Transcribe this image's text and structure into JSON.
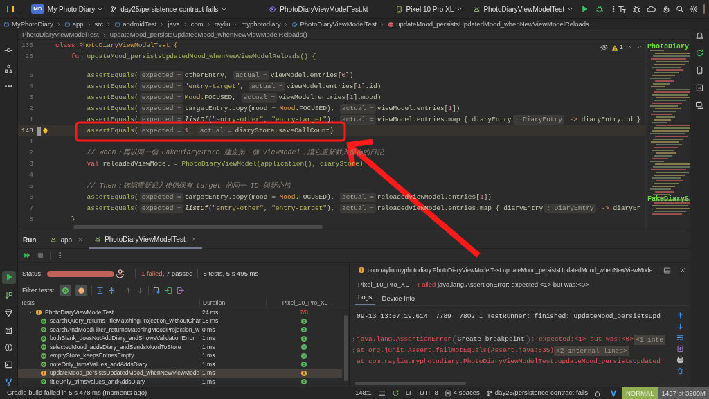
{
  "titlebar": {
    "project_badge": "MD",
    "project": "My Photo Diary",
    "branch": "day25/persistence-contract-fails",
    "file": "PhotoDiaryViewModelTest.kt",
    "device": "Pixel 10 Pro XL",
    "run_config": "PhotoDiaryViewModelTest"
  },
  "breadcrumbs": [
    {
      "text": "MyPhotoDiary",
      "kind": "module"
    },
    {
      "text": "app",
      "kind": "folder"
    },
    {
      "text": "src",
      "kind": "plain"
    },
    {
      "text": "androidTest",
      "kind": "folder"
    },
    {
      "text": "java",
      "kind": "plain"
    },
    {
      "text": "com",
      "kind": "plain"
    },
    {
      "text": "rayliu",
      "kind": "plain"
    },
    {
      "text": "myphotodiary",
      "kind": "plain"
    },
    {
      "text": "PhotoDiaryViewModelTest",
      "kind": "class"
    },
    {
      "text": "updateMood_persistsUpdatedMood_whenNewViewModelReloads",
      "kind": "method"
    }
  ],
  "editor": {
    "path": [
      "PhotoDiaryViewModelTest",
      "updateMood_persistsUpdatedMood_whenNewViewModelReloads()"
    ],
    "warnings": "1",
    "sticky_lines": [
      {
        "number": "135",
        "tokens": [
          {
            "text": "class ",
            "kind": "kw"
          },
          {
            "text": "PhotoDiaryViewModelTest {",
            "kind": "type"
          }
        ]
      },
      {
        "number": "25",
        "tokens": [
          {
            "text": "    fun ",
            "kind": "kw"
          },
          {
            "text": "updateMood_persistsUpdatedMood_whenNewViewModelReloads() {",
            "kind": "fn"
          }
        ]
      }
    ],
    "lines": [
      {
        "number": "5",
        "current": false,
        "tokens": [
          {
            "text": "        assertEquals(",
            "kind": "fn"
          },
          {
            "text": "expected =",
            "kind": "hint"
          },
          {
            "text": "otherEntry, ",
            "kind": "plain"
          },
          {
            "text": "actual =",
            "kind": "hint"
          },
          {
            "text": "viewModel.entries[",
            "kind": "plain"
          },
          {
            "text": "0",
            "kind": "num"
          },
          {
            "text": "])",
            "kind": "plain"
          }
        ]
      },
      {
        "number": "4",
        "current": false,
        "tokens": [
          {
            "text": "        assertEquals(",
            "kind": "fn"
          },
          {
            "text": "expected =",
            "kind": "hint"
          },
          {
            "text": "\"entry-target\"",
            "kind": "str"
          },
          {
            "text": ", ",
            "kind": "plain"
          },
          {
            "text": "actual =",
            "kind": "hint"
          },
          {
            "text": "viewModel.entries[",
            "kind": "plain"
          },
          {
            "text": "1",
            "kind": "num"
          },
          {
            "text": "].id)",
            "kind": "plain"
          }
        ]
      },
      {
        "number": "3",
        "current": false,
        "tokens": [
          {
            "text": "        assertEquals(",
            "kind": "fn"
          },
          {
            "text": "expected =",
            "kind": "hint"
          },
          {
            "text": "Mood",
            "kind": "type"
          },
          {
            "text": ".FOCUSED, ",
            "kind": "plain"
          },
          {
            "text": "actual =",
            "kind": "hint"
          },
          {
            "text": "viewModel.entries[",
            "kind": "plain"
          },
          {
            "text": "1",
            "kind": "num"
          },
          {
            "text": "].mood)",
            "kind": "plain"
          }
        ]
      },
      {
        "number": "2",
        "current": false,
        "tokens": [
          {
            "text": "        assertEquals(",
            "kind": "fn"
          },
          {
            "text": "expected =",
            "kind": "hint"
          },
          {
            "text": "targetEntry.copy(mood = ",
            "kind": "plain"
          },
          {
            "text": "Mood",
            "kind": "type"
          },
          {
            "text": ".FOCUSED), ",
            "kind": "plain"
          },
          {
            "text": "actual =",
            "kind": "hint"
          },
          {
            "text": "viewModel.entries[",
            "kind": "plain"
          },
          {
            "text": "1",
            "kind": "num"
          },
          {
            "text": "])",
            "kind": "plain"
          }
        ]
      },
      {
        "number": "1",
        "current": false,
        "tokens": [
          {
            "text": "        assertEquals(",
            "kind": "fn"
          },
          {
            "text": "expected =",
            "kind": "hint"
          },
          {
            "text": "listOf",
            "kind": "italic"
          },
          {
            "text": "(",
            "kind": "plain"
          },
          {
            "text": "\"entry-other\", \"entry-target\"",
            "kind": "str"
          },
          {
            "text": "), ",
            "kind": "plain"
          },
          {
            "text": "actual =",
            "kind": "hint"
          },
          {
            "text": "viewModel.entries.map { diaryEntry",
            "kind": "plain"
          },
          {
            "text": ": DiaryEntry",
            "kind": "hint"
          },
          {
            "text": " -> ",
            "kind": "op"
          },
          {
            "text": "diaryEntry.id }",
            "kind": "plain"
          }
        ]
      },
      {
        "number": "148",
        "current": true,
        "tokens": [
          {
            "text": "        assertEquals(",
            "kind": "fn"
          },
          {
            "text": "expected =",
            "kind": "hint"
          },
          {
            "text": "1",
            "kind": "num"
          },
          {
            "text": ", ",
            "kind": "plain"
          },
          {
            "text": "actual =",
            "kind": "hint"
          },
          {
            "text": "diaryStore.saveCallCount)",
            "kind": "plain"
          }
        ]
      },
      {
        "number": "1",
        "current": false
      },
      {
        "number": "2",
        "current": false,
        "tokens": [
          {
            "text": "        // When：再以同一個 FakeDiaryStore 建立第二個 ViewModel，讓它重新載入保存的日記",
            "kind": "comment"
          }
        ]
      },
      {
        "number": "3",
        "current": false,
        "tokens": [
          {
            "text": "        val ",
            "kind": "kw"
          },
          {
            "text": "reloadedViewModel = ",
            "kind": "plain"
          },
          {
            "text": "PhotoDiaryViewModel(application(), diaryStore)",
            "kind": "fn"
          }
        ]
      },
      {
        "number": "4",
        "current": false
      },
      {
        "number": "5",
        "current": false,
        "tokens": [
          {
            "text": "        // Then：確認重新載入後仍保有 target 的同一 ID 與新心情",
            "kind": "comment"
          }
        ]
      },
      {
        "number": "6",
        "current": false,
        "tokens": [
          {
            "text": "        assertEquals(",
            "kind": "fn"
          },
          {
            "text": "expected =",
            "kind": "hint"
          },
          {
            "text": "targetEntry.copy(mood = ",
            "kind": "plain"
          },
          {
            "text": "Mood",
            "kind": "type"
          },
          {
            "text": ".FOCUSED), ",
            "kind": "plain"
          },
          {
            "text": "actual =",
            "kind": "hint"
          },
          {
            "text": "reloadedViewModel.entries[",
            "kind": "plain"
          },
          {
            "text": "1",
            "kind": "num"
          },
          {
            "text": "])",
            "kind": "plain"
          }
        ]
      },
      {
        "number": "7",
        "current": false,
        "tokens": [
          {
            "text": "        assertEquals(",
            "kind": "fn"
          },
          {
            "text": "expected =",
            "kind": "hint"
          },
          {
            "text": "listOf",
            "kind": "italic"
          },
          {
            "text": "(",
            "kind": "plain"
          },
          {
            "text": "\"entry-other\", \"entry-target\"",
            "kind": "str"
          },
          {
            "text": "), ",
            "kind": "plain"
          },
          {
            "text": "actual =",
            "kind": "hint"
          },
          {
            "text": "reloadedViewModel.entries.map { diaryEntry",
            "kind": "plain"
          },
          {
            "text": ": DiaryEntry",
            "kind": "hint"
          },
          {
            "text": " -> ",
            "kind": "op"
          },
          {
            "text": "diaryEr",
            "kind": "plain"
          }
        ]
      },
      {
        "number": "8",
        "current": false,
        "tokens": [
          {
            "text": "    }",
            "kind": "plain"
          }
        ]
      }
    ],
    "minimap_labels": [
      "PhotoDiary",
      "FakeDiaryS"
    ]
  },
  "run_panel": {
    "label": "Run",
    "tabs": [
      {
        "label": "app",
        "selected": false
      },
      {
        "label": "PhotoDiaryViewModelTest",
        "selected": true
      }
    ],
    "status": {
      "label": "Status",
      "level": 1,
      "failed": "1 failed",
      "passed": ", 7 passed",
      "summary": "8 tests, 5 s 495 ms"
    },
    "filter": {
      "label": "Filter tests:",
      "toggles": [
        {
          "kind": "passed",
          "selected": true
        },
        {
          "kind": "ignored",
          "selected": true
        }
      ]
    },
    "columns": [
      "Tests",
      "Duration",
      "Pixel_10_Pro_XL"
    ],
    "root": {
      "name": "PhotoDiaryViewModelTest",
      "kind": "failed",
      "duration": "24 ms",
      "device": "7/8",
      "expanded": true,
      "selected": false,
      "children": [
        {
          "name": "searchQuery_returnsTitleMatchingProjection_withoutChar",
          "kind": "passed",
          "duration": "18 ms",
          "selected": false
        },
        {
          "name": "searchAndMoodFilter_returnsMatchingMoodProjection_w",
          "kind": "passed",
          "duration": "0 ms",
          "selected": false
        },
        {
          "name": "bothBlank_doesNotAddDiary_andShowsValidationError",
          "kind": "passed",
          "duration": "1 ms",
          "selected": false
        },
        {
          "name": "selectedMood_addsDiary_andSendsMoodToStore",
          "kind": "passed",
          "duration": "1 ms",
          "selected": false
        },
        {
          "name": "emptyStore_keepsEntriesEmpty",
          "kind": "passed",
          "duration": "1 ms",
          "selected": false
        },
        {
          "name": "noteOnly_trimsValues_andAddsDiary",
          "kind": "passed",
          "duration": "1 ms",
          "selected": false
        },
        {
          "name": "updateMood_persistsUpdatedMood_whenNewViewMode",
          "kind": "failed",
          "duration": "1 ms",
          "selected": true
        },
        {
          "name": "titleOnly_trimsValues_andAddsDiary",
          "kind": "passed",
          "duration": "1 ms",
          "selected": false
        }
      ]
    },
    "details": {
      "title": "com.rayliu.myphotodiary.PhotoDiaryViewModelTest.updateMood_persistsUpdatedMood_whenNewViewMode...",
      "device": "Pixel_10_Pro_XL",
      "result": "Failed",
      "message": "java.lang.AssertionError: expected:<1> but was:<0>",
      "tabs": [
        {
          "label": "Logs",
          "selected": true
        },
        {
          "label": "Device Info",
          "selected": false
        }
      ],
      "log_lines": [
        "09-13 13:07:19.614  7789  7802 I TestRunner: finished: updateMood_persistsUpd"
      ],
      "stack": [
        {
          "expandable": true,
          "segments": [
            {
              "text": "java.lang.",
              "kind": "err"
            },
            {
              "text": "AssertionError",
              "kind": "link"
            },
            {
              "text": "Create breakpoint",
              "kind": "button"
            },
            {
              "text": ": expected:<1> but was:<0>",
              "kind": "err"
            },
            {
              "text": "<1 inte",
              "kind": "fold"
            }
          ]
        },
        {
          "expandable": true,
          "segments": [
            {
              "text": "at org.junit.Assert.failNotEquals(",
              "kind": "err"
            },
            {
              "text": "Assert.java:835",
              "kind": "link"
            },
            {
              "text": ")",
              "kind": "err"
            },
            {
              "text": "<2 internal lines>",
              "kind": "fold"
            }
          ]
        },
        {
          "expandable": false,
          "segments": [
            {
              "text": "at com.rayliu.myphotodiary.PhotoDiaryViewModelTest.updateMood_persistsUpdated",
              "kind": "err"
            }
          ]
        }
      ]
    }
  },
  "status_bar": {
    "build": "Gradle build failed in 5 s 478 ms (moments ago)",
    "position": "148:1",
    "line_separator": "LF",
    "encoding": "UTF-8",
    "indent": "4 spaces",
    "branch": "day25/persistence-contract-fails",
    "vim_mode": "NORMAL",
    "memory": "1437 of 3200M"
  }
}
